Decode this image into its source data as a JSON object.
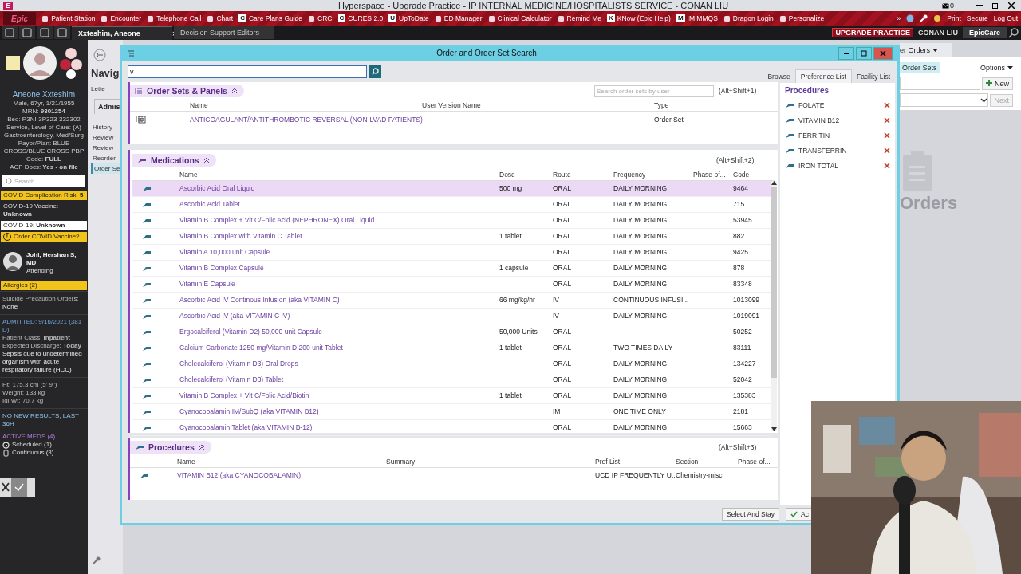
{
  "window": {
    "logo": "E",
    "title": "Hyperspace - Upgrade Practice - IP INTERNAL MEDICINE/HOSPITALISTS  SERVICE - CONAN LIU",
    "mail_count": "0"
  },
  "toolbar": {
    "logo": "Epic",
    "items": [
      {
        "label": "Patient Station"
      },
      {
        "label": "Encounter"
      },
      {
        "label": "Telephone Call"
      },
      {
        "label": "Chart"
      },
      {
        "label": "Care Plans Guide",
        "badge": "C"
      },
      {
        "label": "CRC"
      },
      {
        "label": "CURES 2.0",
        "badge": "C"
      },
      {
        "label": "UpToDate",
        "badge": "U"
      },
      {
        "label": "ED Manager"
      },
      {
        "label": "Clinical Calculator"
      },
      {
        "label": "Remind Me"
      },
      {
        "label": "KNow (Epic Help)",
        "badge": "K"
      },
      {
        "label": "IM MMQS",
        "badge": "M"
      },
      {
        "label": "Dragon Login"
      },
      {
        "label": "Personalize"
      }
    ],
    "overflow_glyph": "»",
    "right_items": [
      {
        "label": "Print"
      },
      {
        "label": "Secure"
      },
      {
        "label": "Log Out"
      }
    ]
  },
  "tabs": [
    {
      "label": "Xxteshim, Aneone",
      "selected": true
    },
    {
      "label": "Decision Support Editors",
      "selected": false
    }
  ],
  "environment": {
    "badge": "UPGRADE PRACTICE",
    "user": "CONAN LIU",
    "app": "EpicCare"
  },
  "patient": {
    "name": "Aneone Xxteshim",
    "details": [
      "Male, 67yr, 1/21/1955",
      "MRN: **9301254**",
      "Bed: P3NI-3P323-332302",
      "Service, Level of Care: (A) Gastroenterology, Med/Surg",
      "Payor/Plan: BLUE CROSS/BLUE CROSS PBP",
      "Code: **FULL**",
      "ACP Docs: **Yes - on file**"
    ],
    "search_placeholder": "Search",
    "flags": [
      {
        "kind": "warning",
        "text": "COVID Complication Risk: **5**"
      },
      {
        "kind": "plain",
        "text": "COVID-19 Vaccine: **Unknown**"
      },
      {
        "kind": "light",
        "text": "COVID-19: **Unknown**"
      },
      {
        "kind": "alert",
        "text": "Order COVID Vaccine?",
        "glyph": "!"
      }
    ],
    "attending": {
      "name": "Johl, Hershan S, MD",
      "role": "Attending"
    },
    "allergies": "Allergies (2)",
    "suicide": {
      "label": "Suicide Precaution Orders:",
      "value": "None"
    },
    "admitted": "ADMITTED: 9/16/2021 (381 D)",
    "admission_lines": [
      "Patient Class: **Inpatient**",
      "Expected Discharge: **Today**"
    ],
    "diagnosis": "Sepsis due to undetermined organism with acute respiratory failure (HCC)",
    "measurements": [
      "Ht:  175.3 cm (5' 9\")",
      "Weight:  133 kg",
      "Idl Wt:  70.7 kg"
    ],
    "results": "NO NEW RESULTS, LAST 36H",
    "toggle": {
      "checked": true
    },
    "active_meds": {
      "title": "ACTIVE MEDS (4)",
      "items": [
        {
          "kind": "scheduled",
          "label": "Scheduled (1)"
        },
        {
          "kind": "continuous",
          "label": "Continuous (3)"
        }
      ]
    }
  },
  "navigator": {
    "title": "Navig",
    "letter": "Lette",
    "tab": "Admis",
    "items": [
      {
        "label": "History",
        "selected": false
      },
      {
        "label": "Review",
        "selected": false
      },
      {
        "label": "Review",
        "selected": false
      },
      {
        "label": "Reorder",
        "selected": false
      },
      {
        "label": "Order Se",
        "selected": true
      }
    ]
  },
  "background_activity": {
    "tab": "er Orders",
    "section": "Order Sets",
    "options": "Options",
    "new_button": "New",
    "next_button": "Next",
    "empty_title": "Orders"
  },
  "dialog": {
    "title": "Order and Order Set Search",
    "search_value": "v",
    "tabs": [
      {
        "label": "Browse",
        "selected": false
      },
      {
        "label": "Preference List",
        "selected": true
      },
      {
        "label": "Facility List",
        "selected": false
      }
    ],
    "order_sets": {
      "title": "Order Sets & Panels",
      "shortcut": "(Alt+Shift+1)",
      "search_placeholder": "Search order sets by user",
      "columns": [
        "Name",
        "User Version Name",
        "Type"
      ],
      "rows": [
        {
          "name": "ANTICOAGULANT/ANTITHROMBOTIC REVERSAL (NON-LVAD PATIENTS)",
          "type": "Order Set"
        }
      ]
    },
    "medications": {
      "title": "Medications",
      "shortcut": "(Alt+Shift+2)",
      "columns": [
        "Name",
        "Dose",
        "Route",
        "Frequency",
        "Phase of...",
        "Code"
      ],
      "rows": [
        {
          "name": "Ascorbic Acid Oral Liquid",
          "dose": "500 mg",
          "route": "ORAL",
          "frequency": "DAILY MORNING",
          "code": "9464",
          "selected": true
        },
        {
          "name": "Ascorbic Acid Tablet",
          "route": "ORAL",
          "frequency": "DAILY MORNING",
          "code": "715",
          "selected": false
        },
        {
          "name": "Vitamin B Complex + Vit C/Folic Acid (NEPHRONEX) Oral Liquid",
          "route": "ORAL",
          "frequency": "DAILY MORNING",
          "code": "53945",
          "selected": false
        },
        {
          "name": "Vitamin B Complex with Vitamin C Tablet",
          "dose": "1 tablet",
          "route": "ORAL",
          "frequency": "DAILY MORNING",
          "code": "882",
          "selected": false
        },
        {
          "name": "Vitamin A 10,000 unit Capsule",
          "route": "ORAL",
          "frequency": "DAILY MORNING",
          "code": "9425",
          "selected": false
        },
        {
          "name": "Vitamin B Complex Capsule",
          "dose": "1 capsule",
          "route": "ORAL",
          "frequency": "DAILY MORNING",
          "code": "878",
          "selected": false
        },
        {
          "name": "Vitamin E Capsule",
          "route": "ORAL",
          "frequency": "DAILY MORNING",
          "code": "83348",
          "selected": false
        },
        {
          "name": "Ascorbic Acid IV Continous Infusion (aka VITAMIN C)",
          "dose": "66 mg/kg/hr",
          "route": "IV",
          "frequency": "CONTINUOUS INFUSI...",
          "code": "1013099",
          "selected": false
        },
        {
          "name": "Ascorbic Acid IV (aka VITAMIN C IV)",
          "route": "IV",
          "frequency": "DAILY MORNING",
          "code": "1019091",
          "selected": false
        },
        {
          "name": "Ergocalciferol (Vitamin D2) 50,000 unit Capsule",
          "dose": "50,000 Units",
          "route": "ORAL",
          "code": "50252",
          "selected": false
        },
        {
          "name": "Calcium Carbonate 1250 mg/Vitamin D 200 unit Tablet",
          "dose": "1 tablet",
          "route": "ORAL",
          "frequency": "TWO TIMES DAILY",
          "code": "83111",
          "selected": false
        },
        {
          "name": "Cholecalciferol (Vitamin D3) Oral Drops",
          "route": "ORAL",
          "frequency": "DAILY MORNING",
          "code": "134227",
          "selected": false
        },
        {
          "name": "Cholecalciferol (Vitamin D3) Tablet",
          "route": "ORAL",
          "frequency": "DAILY MORNING",
          "code": "52042",
          "selected": false
        },
        {
          "name": "Vitamin B Complex + Vit C/Folic Acid/Biotin",
          "dose": "1 tablet",
          "route": "ORAL",
          "frequency": "DAILY MORNING",
          "code": "135383",
          "selected": false
        },
        {
          "name": "Cyanocobalamin IM/SubQ (aka VITAMIN B12)",
          "route": "IM",
          "frequency": "ONE TIME ONLY",
          "code": "2181",
          "selected": false
        },
        {
          "name": "Cyanocobalamin Tablet (aka VITAMIN B-12)",
          "route": "ORAL",
          "frequency": "DAILY MORNING",
          "code": "15663",
          "selected": false
        }
      ]
    },
    "procedures": {
      "title": "Procedures",
      "shortcut": "(Alt+Shift+3)",
      "columns": [
        "Name",
        "Summary",
        "Pref List",
        "Section",
        "Phase of..."
      ],
      "rows": [
        {
          "name": "VITAMIN B12 (aka CYANOCOBALAMIN)",
          "pref_list": "UCD IP FREQUENTLY U...",
          "section": "Chemistry-misc"
        }
      ]
    },
    "preference_panel": {
      "title": "Procedures",
      "items": [
        "FOLATE",
        "VITAMIN B12",
        "FERRITIN",
        "TRANSFERRIN",
        "IRON TOTAL"
      ]
    },
    "buttons": [
      {
        "label": "Select And Stay",
        "kind": "plain"
      },
      {
        "label": "Ac",
        "kind": "accept"
      }
    ]
  }
}
